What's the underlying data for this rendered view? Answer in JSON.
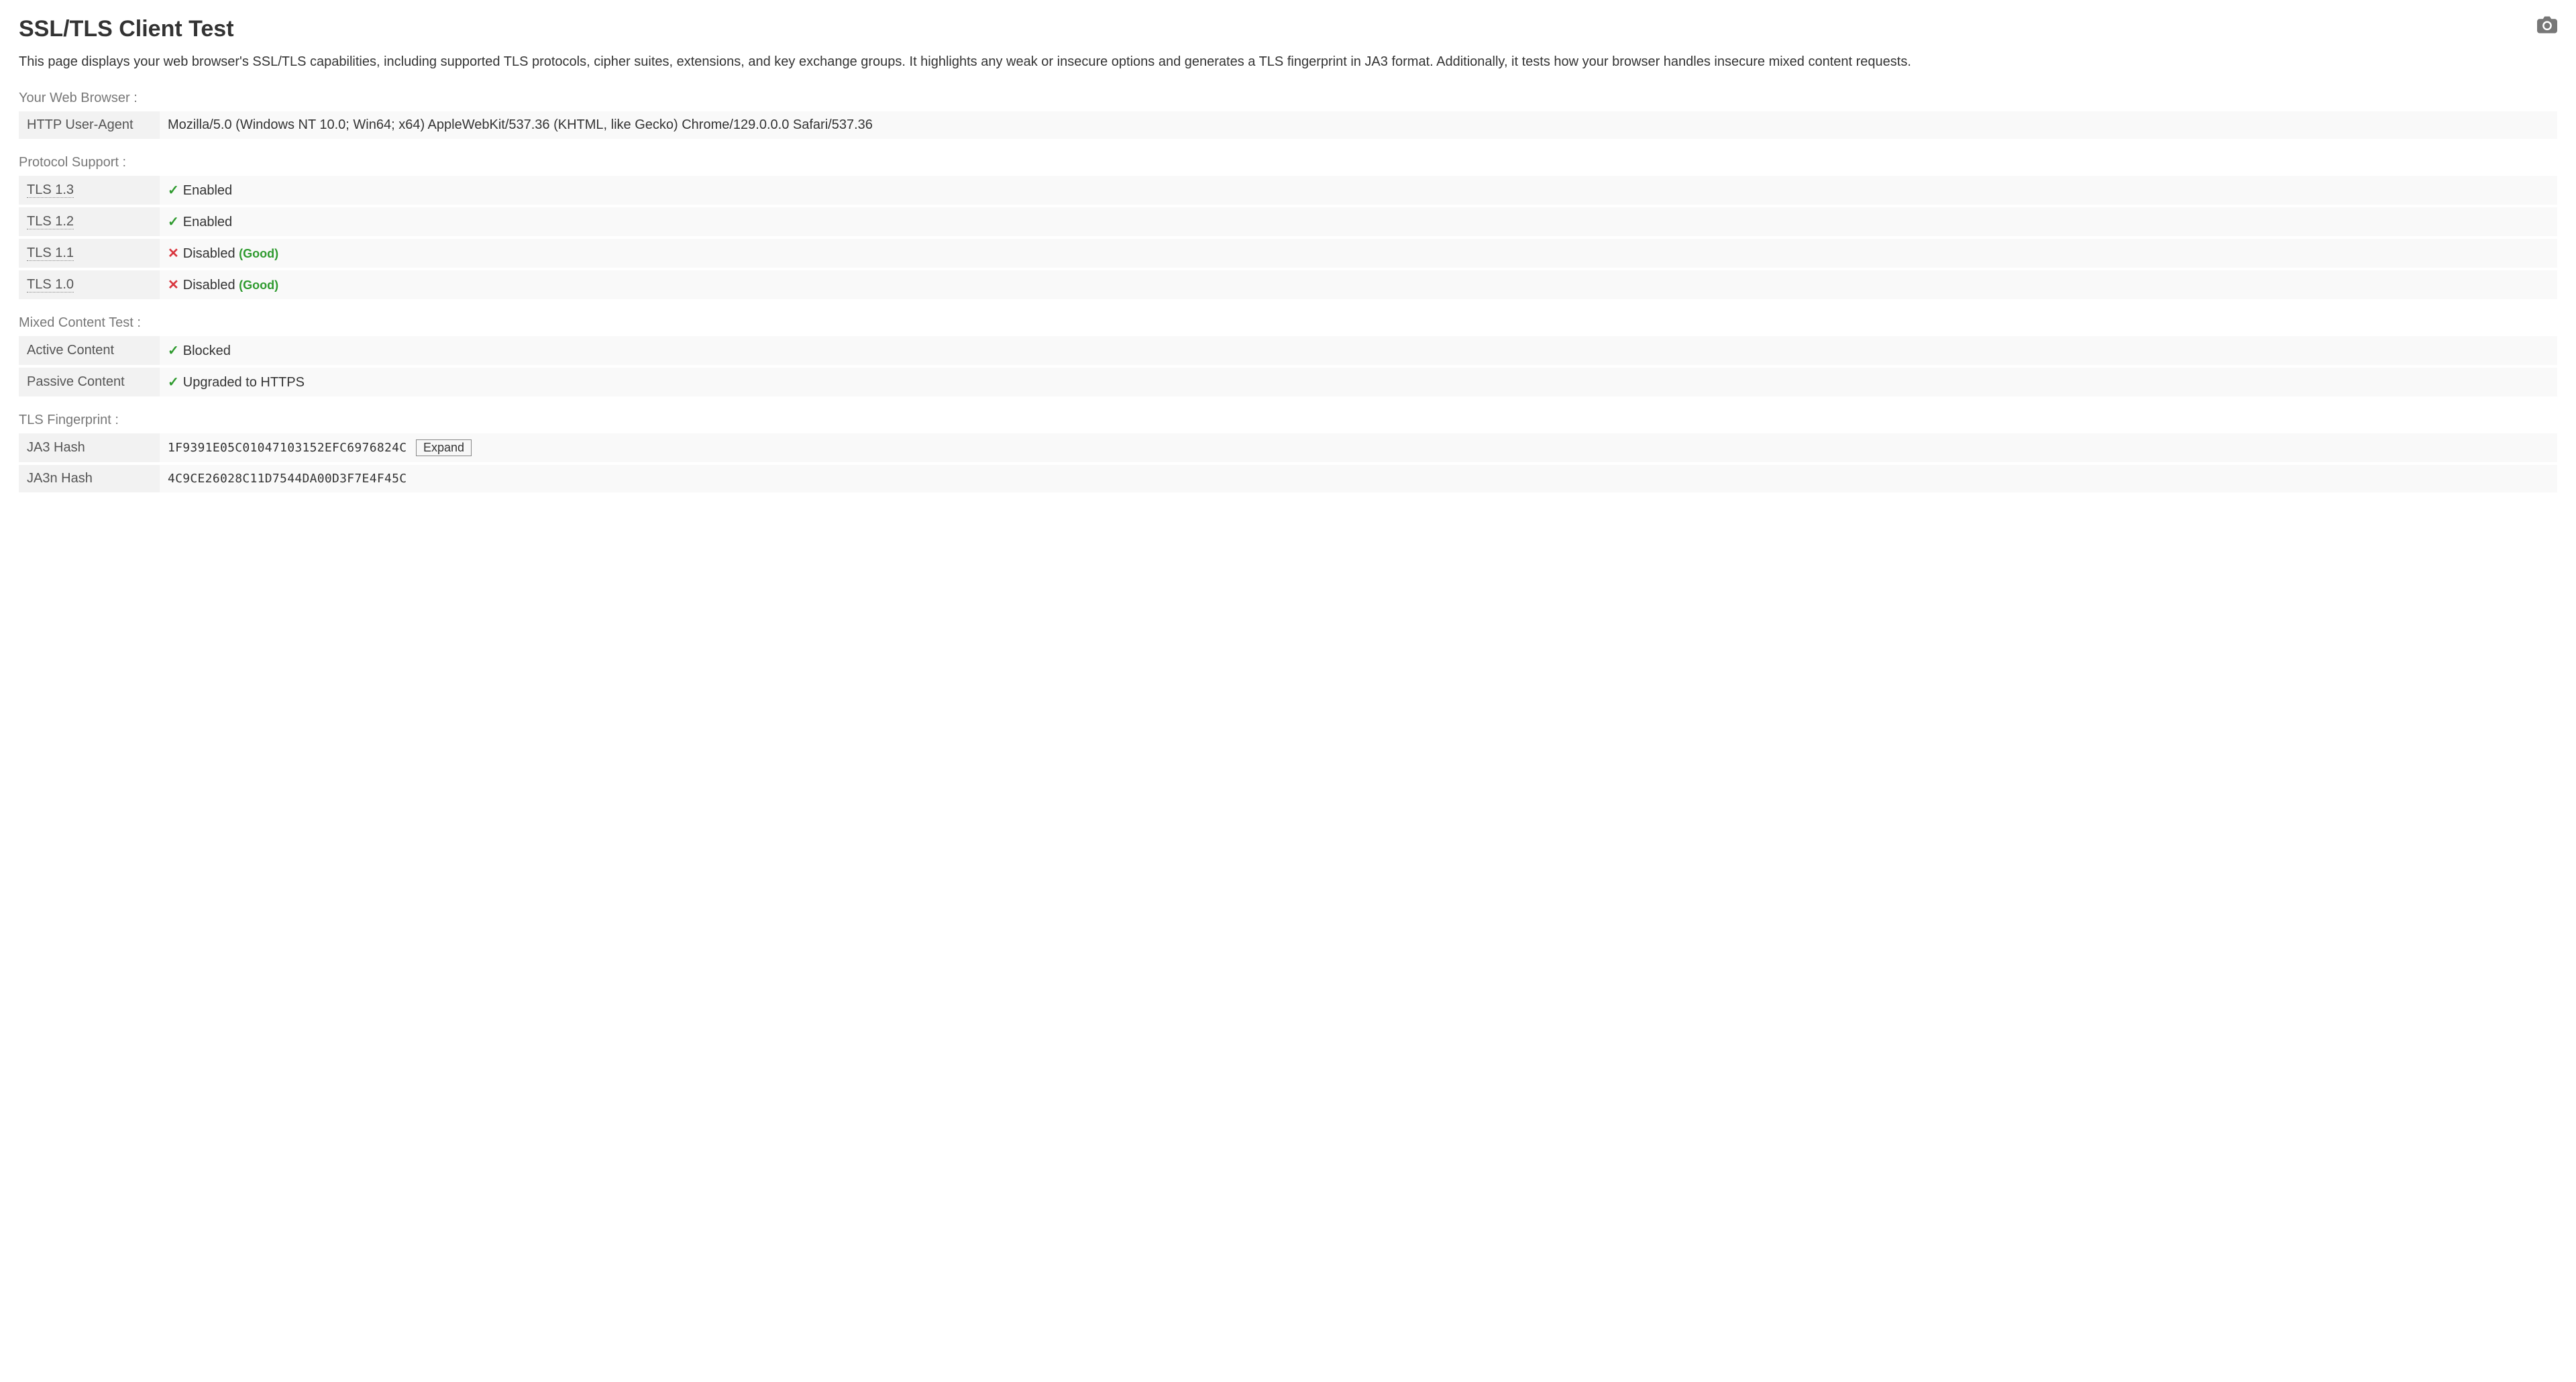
{
  "header": {
    "title": "SSL/TLS Client Test",
    "intro": "This page displays your web browser's SSL/TLS capabilities, including supported TLS protocols, cipher suites, extensions, and key exchange groups. It highlights any weak or insecure options and generates a TLS fingerprint in JA3 format. Additionally, it tests how your browser handles insecure mixed content requests."
  },
  "sections": {
    "browser": {
      "title": "Your Web Browser :",
      "rows": [
        {
          "label": "HTTP User-Agent",
          "value": "Mozilla/5.0 (Windows NT 10.0; Win64; x64) AppleWebKit/537.36 (KHTML, like Gecko) Chrome/129.0.0.0 Safari/537.36"
        }
      ]
    },
    "protocol": {
      "title": "Protocol Support :",
      "rows": [
        {
          "label": "TLS 1.3",
          "status": "Enabled",
          "icon": "check",
          "note": ""
        },
        {
          "label": "TLS 1.2",
          "status": "Enabled",
          "icon": "check",
          "note": ""
        },
        {
          "label": "TLS 1.1",
          "status": "Disabled",
          "icon": "cross",
          "note": "(Good)"
        },
        {
          "label": "TLS 1.0",
          "status": "Disabled",
          "icon": "cross",
          "note": "(Good)"
        }
      ]
    },
    "mixed": {
      "title": "Mixed Content Test :",
      "rows": [
        {
          "label": "Active Content",
          "status": "Blocked",
          "icon": "check"
        },
        {
          "label": "Passive Content",
          "status": "Upgraded to HTTPS",
          "icon": "check"
        }
      ]
    },
    "fingerprint": {
      "title": "TLS Fingerprint :",
      "rows": [
        {
          "label": "JA3 Hash",
          "value": "1F9391E05C01047103152EFC6976824C",
          "expand": "Expand"
        },
        {
          "label": "JA3n Hash",
          "value": "4C9CE26028C11D7544DA00D3F7E4F45C"
        }
      ]
    }
  },
  "icons": {
    "check": "✓",
    "cross": "✕"
  }
}
